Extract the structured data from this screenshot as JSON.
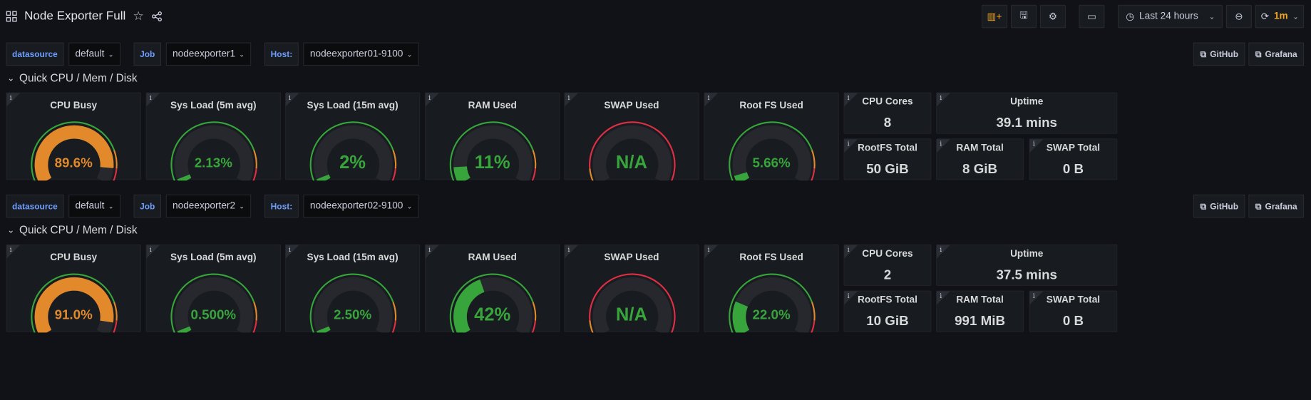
{
  "dashboard": {
    "title": "Node Exporter Full",
    "time_range": "Last 24 hours",
    "refresh": "1m"
  },
  "sections": [
    {
      "vars": {
        "datasource_label": "datasource",
        "datasource_value": "default",
        "job_label": "Job",
        "job_value": "nodeexporter1",
        "host_label": "Host:",
        "host_value": "nodeexporter01-9100"
      },
      "links": [
        "GitHub",
        "Grafana"
      ],
      "row_title": "Quick CPU / Mem / Disk",
      "gauges": [
        {
          "title": "CPU Busy",
          "value": "89.6%",
          "fraction": 0.896,
          "color": "#e28a2b",
          "track": "threshold"
        },
        {
          "title": "Sys Load (5m avg)",
          "value": "2.13%",
          "fraction": 0.0213,
          "color": "#37a53b",
          "track": "threshold"
        },
        {
          "title": "Sys Load (15m avg)",
          "value": "2%",
          "fraction": 0.02,
          "color": "#37a53b",
          "track": "threshold"
        },
        {
          "title": "RAM Used",
          "value": "11%",
          "fraction": 0.11,
          "color": "#37a53b",
          "track": "threshold"
        },
        {
          "title": "SWAP Used",
          "value": "N/A",
          "fraction": 0,
          "color": "#37a53b",
          "track": "swap"
        },
        {
          "title": "Root FS Used",
          "value": "5.66%",
          "fraction": 0.0566,
          "color": "#37a53b",
          "track": "threshold"
        }
      ],
      "stats_top": [
        {
          "title": "CPU Cores",
          "value": "8"
        },
        {
          "title": "Uptime",
          "value": "39.1 mins"
        }
      ],
      "stats_bottom": [
        {
          "title": "RootFS Total",
          "value": "50 GiB"
        },
        {
          "title": "RAM Total",
          "value": "8 GiB"
        },
        {
          "title": "SWAP Total",
          "value": "0 B"
        }
      ]
    },
    {
      "vars": {
        "datasource_label": "datasource",
        "datasource_value": "default",
        "job_label": "Job",
        "job_value": "nodeexporter2",
        "host_label": "Host:",
        "host_value": "nodeexporter02-9100"
      },
      "links": [
        "GitHub",
        "Grafana"
      ],
      "row_title": "Quick CPU / Mem / Disk",
      "gauges": [
        {
          "title": "CPU Busy",
          "value": "91.0%",
          "fraction": 0.91,
          "color": "#e28a2b",
          "track": "threshold"
        },
        {
          "title": "Sys Load (5m avg)",
          "value": "0.500%",
          "fraction": 0.005,
          "color": "#37a53b",
          "track": "threshold"
        },
        {
          "title": "Sys Load (15m avg)",
          "value": "2.50%",
          "fraction": 0.025,
          "color": "#37a53b",
          "track": "threshold"
        },
        {
          "title": "RAM Used",
          "value": "42%",
          "fraction": 0.42,
          "color": "#37a53b",
          "track": "threshold"
        },
        {
          "title": "SWAP Used",
          "value": "N/A",
          "fraction": 0,
          "color": "#37a53b",
          "track": "swap"
        },
        {
          "title": "Root FS Used",
          "value": "22.0%",
          "fraction": 0.22,
          "color": "#37a53b",
          "track": "threshold"
        }
      ],
      "stats_top": [
        {
          "title": "CPU Cores",
          "value": "2"
        },
        {
          "title": "Uptime",
          "value": "37.5 mins"
        }
      ],
      "stats_bottom": [
        {
          "title": "RootFS Total",
          "value": "10 GiB"
        },
        {
          "title": "RAM Total",
          "value": "991 MiB"
        },
        {
          "title": "SWAP Total",
          "value": "0 B"
        }
      ]
    }
  ],
  "colors": {
    "green": "#37a53b",
    "orange": "#e28a2b",
    "red": "#e02f44",
    "blue_label": "#6e9fff"
  },
  "icons": [
    "apps-icon",
    "star-icon",
    "share-icon",
    "add-panel-icon",
    "save-icon",
    "settings-icon",
    "tv-icon",
    "clock-icon",
    "zoom-out-icon",
    "refresh-icon",
    "external-link-icon",
    "chevron-down-icon",
    "info-icon"
  ]
}
